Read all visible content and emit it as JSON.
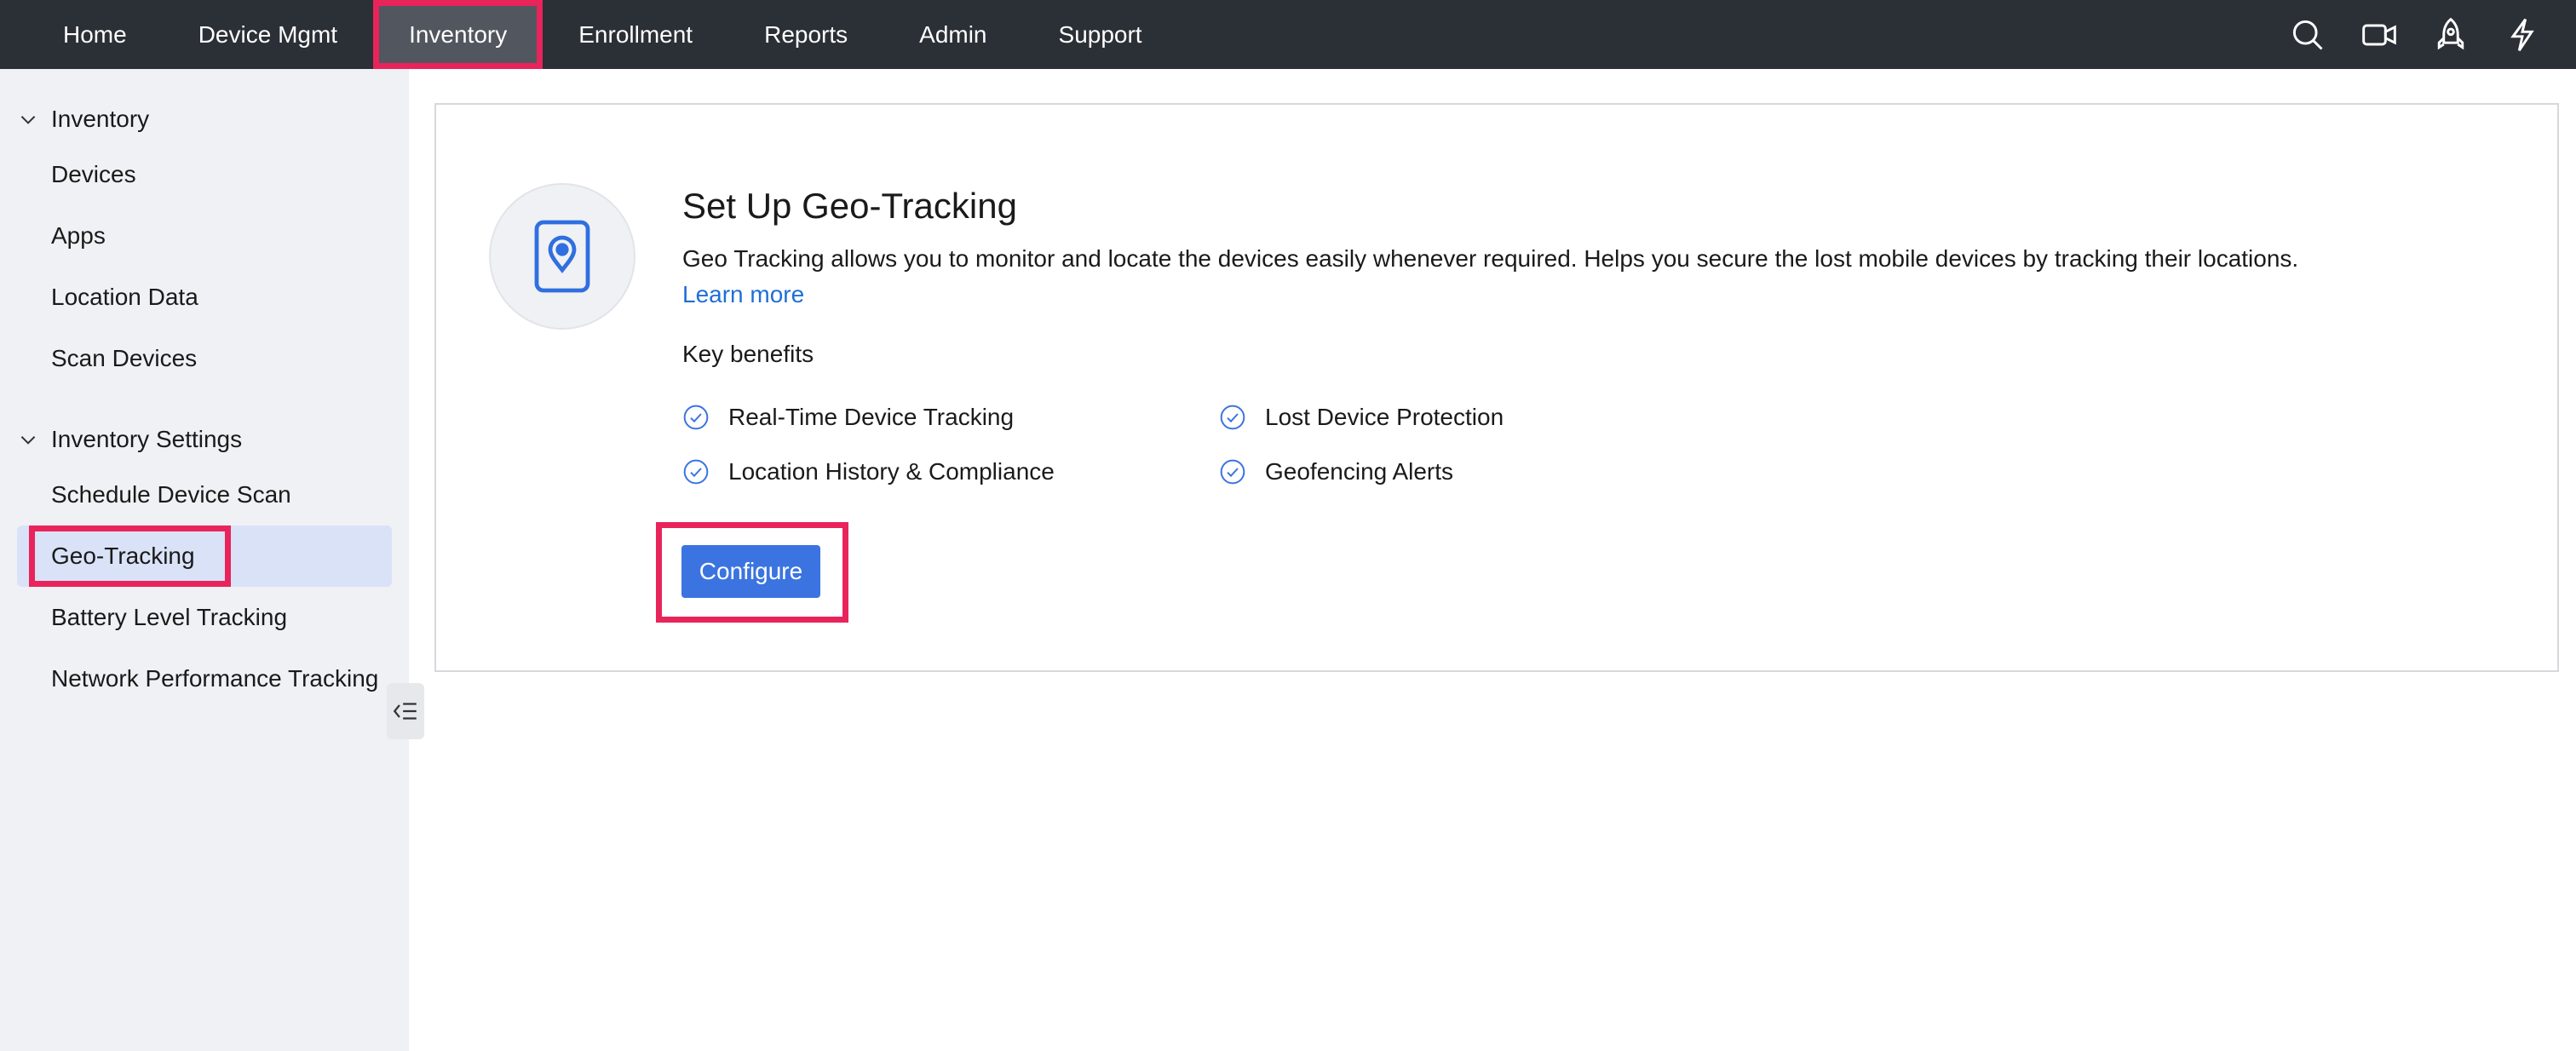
{
  "nav": {
    "items": [
      {
        "label": "Home",
        "active": false
      },
      {
        "label": "Device Mgmt",
        "active": false
      },
      {
        "label": "Inventory",
        "active": true
      },
      {
        "label": "Enrollment",
        "active": false
      },
      {
        "label": "Reports",
        "active": false
      },
      {
        "label": "Admin",
        "active": false
      },
      {
        "label": "Support",
        "active": false
      }
    ],
    "icons": [
      "search-icon",
      "video-icon",
      "rocket-icon",
      "lightning-icon"
    ]
  },
  "sidebar": {
    "section1": {
      "label": "Inventory",
      "items": [
        "Devices",
        "Apps",
        "Location Data",
        "Scan Devices"
      ]
    },
    "section2": {
      "label": "Inventory Settings",
      "items": [
        "Schedule Device Scan",
        "Geo-Tracking",
        "Battery Level Tracking",
        "Network Performance Tracking"
      ],
      "selected": "Geo-Tracking"
    }
  },
  "main": {
    "icon": "location-device-icon",
    "title": "Set Up Geo-Tracking",
    "description": "Geo Tracking allows you to monitor and locate the devices easily whenever required. Helps you secure the lost mobile devices by tracking their locations.",
    "learn_more": "Learn more",
    "key_benefits_title": "Key benefits",
    "benefits": [
      "Real-Time Device Tracking",
      "Lost Device Protection",
      "Location History & Compliance",
      "Geofencing Alerts"
    ],
    "configure_label": "Configure"
  },
  "colors": {
    "topbar": "#2b2f36",
    "accent": "#3b74e0",
    "link": "#1f6fd6",
    "highlight": "#e8245b",
    "sidebar_bg": "#f0f1f4",
    "selected_bg": "#d9e2f7"
  }
}
